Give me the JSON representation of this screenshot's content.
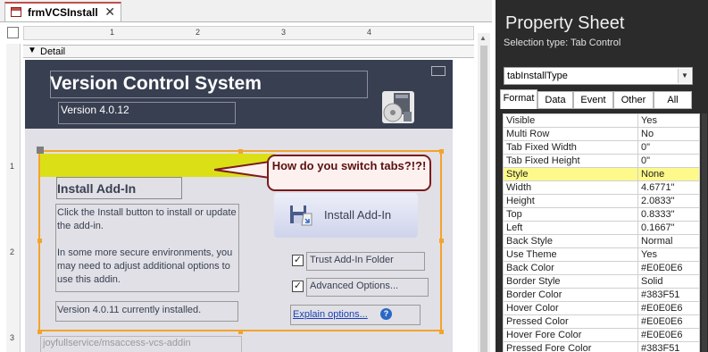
{
  "document_tab": {
    "title": "frmVCSInstall",
    "close": "✕"
  },
  "section": {
    "label": "Detail"
  },
  "rulers": {
    "horizontal": [
      "1",
      "2",
      "3",
      "4"
    ],
    "vertical": [
      "1",
      "2",
      "3"
    ]
  },
  "form": {
    "title": "Version Control System",
    "version": "Version 4.0.12",
    "install_heading": "Install Add-In",
    "description_1": "Click the Install button to install or update the add-in.",
    "description_2": "In some more secure environments, you may need to adjust additional options to use this addin.",
    "current_status": "Version 4.0.11 currently installed.",
    "install_button": "Install Add-In",
    "trust_label": "Trust Add-In Folder",
    "trust_checked": true,
    "advanced_label": "Advanced Options...",
    "advanced_checked": true,
    "explain_link": "Explain options...",
    "url": "joyfullservice/msaccess-vcs-addin",
    "header_color": "#383F51",
    "body_color": "#E0E0E6",
    "selection_color": "#F4A32B",
    "highlight_color": "#DBE016"
  },
  "callout": {
    "text": "How do you switch tabs?!?!"
  },
  "property_sheet": {
    "title": "Property Sheet",
    "selection_type": "Selection type:  Tab Control",
    "selected_object": "tabInstallType",
    "tabs": [
      "Format",
      "Data",
      "Event",
      "Other",
      "All"
    ],
    "active_tab": "Format",
    "properties": [
      {
        "name": "Visible",
        "value": "Yes"
      },
      {
        "name": "Multi Row",
        "value": "No"
      },
      {
        "name": "Tab Fixed Width",
        "value": "0\""
      },
      {
        "name": "Tab Fixed Height",
        "value": "0\""
      },
      {
        "name": "Style",
        "value": "None",
        "highlighted": true
      },
      {
        "name": "Width",
        "value": "4.6771\""
      },
      {
        "name": "Height",
        "value": "2.0833\""
      },
      {
        "name": "Top",
        "value": "0.8333\""
      },
      {
        "name": "Left",
        "value": "0.1667\""
      },
      {
        "name": "Back Style",
        "value": "Normal"
      },
      {
        "name": "Use Theme",
        "value": "Yes"
      },
      {
        "name": "Back Color",
        "value": "#E0E0E6"
      },
      {
        "name": "Border Style",
        "value": "Solid"
      },
      {
        "name": "Border Color",
        "value": "#383F51"
      },
      {
        "name": "Hover Color",
        "value": "#E0E0E6"
      },
      {
        "name": "Pressed Color",
        "value": "#E0E0E6"
      },
      {
        "name": "Hover Fore Color",
        "value": "#E0E0E6"
      },
      {
        "name": "Pressed Fore Color",
        "value": "#383F51"
      }
    ]
  }
}
